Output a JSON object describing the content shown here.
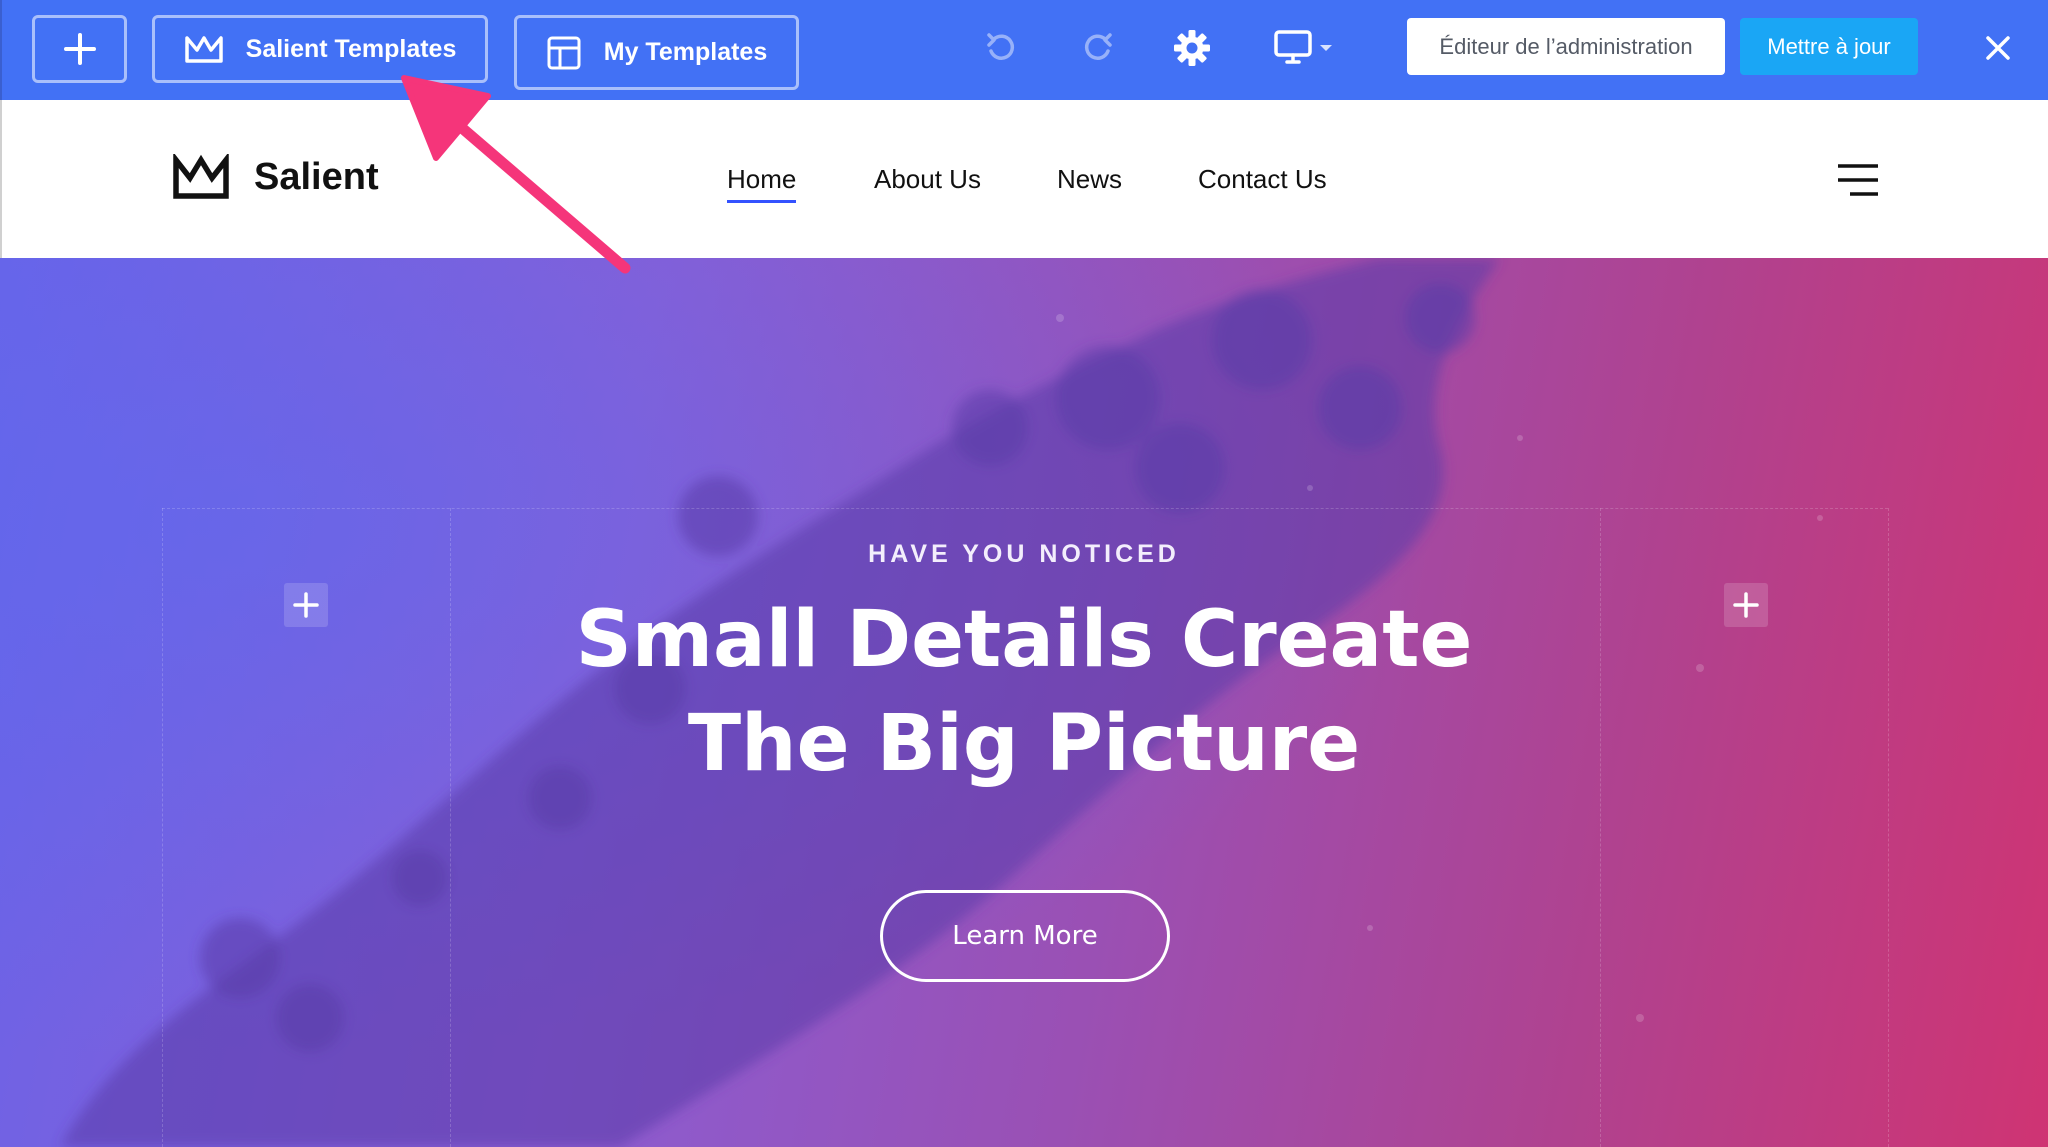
{
  "toolbar": {
    "add_icon": "plus-icon",
    "salient_templates_label": "Salient Templates",
    "salient_templates_icon": "crown-icon",
    "my_templates_label": "My Templates",
    "my_templates_icon": "layout-icon",
    "undo_icon": "undo-icon",
    "redo_icon": "redo-icon",
    "settings_icon": "gear-icon",
    "device_icon": "desktop-icon",
    "admin_editor_label": "Éditeur de l’administration",
    "update_label": "Mettre à jour",
    "close_icon": "close-icon"
  },
  "site": {
    "brand_name": "Salient",
    "brand_icon": "crown-icon",
    "nav": [
      {
        "label": "Home",
        "active": true
      },
      {
        "label": "About Us",
        "active": false
      },
      {
        "label": "News",
        "active": false
      },
      {
        "label": "Contact Us",
        "active": false
      }
    ],
    "menu_icon": "hamburger-icon"
  },
  "hero": {
    "eyebrow": "HAVE YOU NOTICED",
    "headline_line1": "Small Details Create",
    "headline_line2": "The Big Picture",
    "cta_label": "Learn More",
    "add_icon": "plus-icon"
  },
  "colors": {
    "toolbar_bg": "#4271f5",
    "update_button_bg": "#1aa6f5",
    "nav_active_underline": "#3452ff",
    "annotation_arrow": "#f5357a",
    "hero_gradient_start": "#6a63e8",
    "hero_gradient_end": "#cf3473"
  }
}
